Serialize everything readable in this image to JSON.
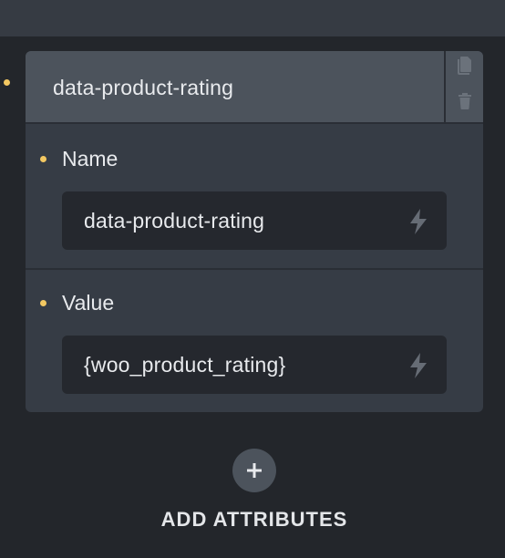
{
  "attribute": {
    "title": "data-product-rating",
    "name_label": "Name",
    "name_value": "data-product-rating",
    "value_label": "Value",
    "value_value": "{woo_product_rating}"
  },
  "actions": {
    "add_label": "ADD ATTRIBUTES"
  },
  "icons": {
    "copy": "copy-icon",
    "delete": "trash-icon",
    "dynamic_data": "bolt-icon",
    "add": "plus-icon"
  },
  "colors": {
    "indicator": "#f3c862",
    "background": "#23262b",
    "card": "#363c45",
    "header": "#4c535c",
    "field": "#25282e"
  }
}
